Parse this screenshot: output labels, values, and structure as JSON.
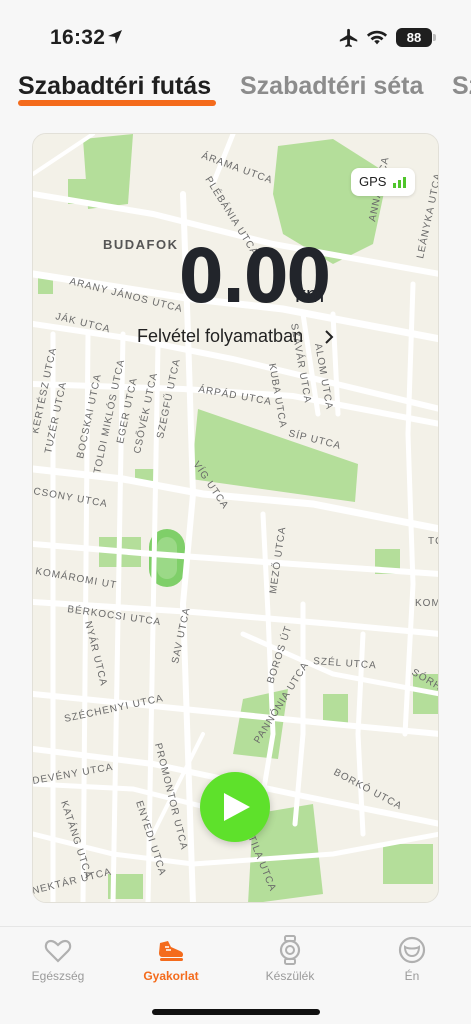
{
  "status_bar": {
    "time": "16:32",
    "battery": "88",
    "icons": [
      "location-arrow-icon",
      "airplane-icon",
      "wifi-icon",
      "battery-icon"
    ]
  },
  "tabs": [
    {
      "label": "Szabadtéri futás",
      "active": true
    },
    {
      "label": "Szabadtéri séta",
      "active": false
    },
    {
      "label": "Sz",
      "active": false
    }
  ],
  "map": {
    "gps_label": "GPS",
    "distance_value": "0.00",
    "distance_unit": "km",
    "recording_label": "Felvétel folyamatban",
    "district": "BUDAFOK",
    "streets": {
      "s1": "ÁRAMA UTCA",
      "s2": "PLÉBÁNIA UTCA",
      "s3": "ANNA UTCA",
      "s4": "LEÁNYKA UTCA",
      "s5": "ARANY JÁNOS UTCA",
      "s6": "JÁK UTCA",
      "s7": "ÁRPÁD UTCA",
      "s8": "KÉRTÉSZ UTCA",
      "s9": "TUZÉR UTCA",
      "s10": "BOCSKAI UTCA",
      "s11": "TOLDI MIKLÓS UTCA",
      "s12": "EGER UTCA",
      "s13": "CSŐVÉK UTCA",
      "s14": "SZEGFŰ UTCA",
      "s15": "SÍP UTCA",
      "s16": "VÍG UTCA",
      "s17": "CSONY UTCA",
      "s18": "KOMÁROMI UT",
      "s19": "BÉRKOCSI UTCA",
      "s20": "NYÁR UTCA",
      "s21": "SAV UTCA",
      "s22": "MEZŐ UTCA",
      "s23": "BOROS ÚT",
      "s24": "SZÉL UTCA",
      "s25": "SZÉCHENYI UTCA",
      "s26": "PANNÓNIA UTCA",
      "s27": "PROMONTOR UTCA",
      "s28": "BORKÓ UTCA",
      "s29": "DEVÉNY UTCA",
      "s30": "KATÁNG UTCA",
      "s31": "ENYEDI UTCA",
      "s32": "ATTILA UTCA",
      "s33": "NEKTÁR UTCA",
      "s34": "KUBA UTCA",
      "s35": "SZÁVÁR UTCA",
      "s36": "ALOM UTCA",
      "s37": "TÓ",
      "s38": "KOM",
      "s39": "SÓRH"
    }
  },
  "bottom_nav": [
    {
      "label": "Egészség",
      "icon": "heart-icon",
      "active": false
    },
    {
      "label": "Gyakorlat",
      "icon": "running-shoe-icon",
      "active": true
    },
    {
      "label": "Készülék",
      "icon": "watch-icon",
      "active": false
    },
    {
      "label": "Én",
      "icon": "profile-icon",
      "active": false
    }
  ],
  "colors": {
    "accent": "#f46b1c",
    "play_button": "#5ee12b",
    "map_background": "#f3f1e8",
    "park": "#a7d98b"
  }
}
